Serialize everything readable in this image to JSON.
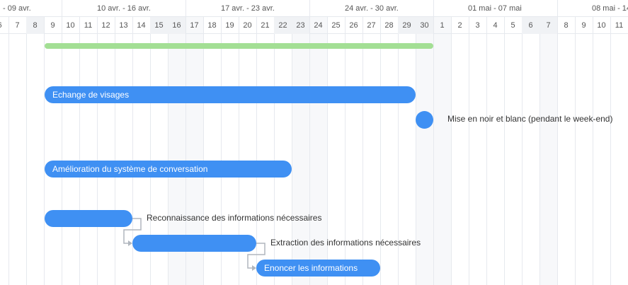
{
  "timeline": {
    "weeks": [
      "- 09 avr.",
      "10 avr. - 16 avr.",
      "17 avr. - 23 avr.",
      "24 avr. - 30 avr.",
      "01 mai - 07 mai",
      "08 mai - 14"
    ],
    "days": [
      "6",
      "7",
      "8",
      "9",
      "10",
      "11",
      "12",
      "13",
      "14",
      "15",
      "16",
      "17",
      "18",
      "19",
      "20",
      "21",
      "22",
      "23",
      "24",
      "25",
      "26",
      "27",
      "28",
      "29",
      "30",
      "1",
      "2",
      "3",
      "4",
      "5",
      "6",
      "7",
      "8",
      "9",
      "10",
      "11"
    ],
    "weekend_days": [
      [
        2,
        "8"
      ],
      [
        9,
        "15"
      ],
      [
        10,
        "16"
      ],
      [
        16,
        "22"
      ],
      [
        17,
        "23"
      ],
      [
        23,
        "29"
      ],
      [
        24,
        "30"
      ],
      [
        30,
        "6"
      ],
      [
        31,
        "7"
      ]
    ]
  },
  "tasks": [
    {
      "id": "summary",
      "name": "",
      "type": "summary",
      "start": "9 avr.",
      "end": "30 avr.",
      "color": "#a3df94"
    },
    {
      "id": "t1",
      "name": "Echange de visages",
      "type": "task",
      "start": "9 avr.",
      "end": "29 avr."
    },
    {
      "id": "m1",
      "name": "Mise en noir et blanc (pendant le week-end)",
      "type": "milestone",
      "date": "30 avr."
    },
    {
      "id": "t2",
      "name": "Amélioration du système de conversation",
      "type": "task",
      "start": "9 avr.",
      "end": "22 avr."
    },
    {
      "id": "t3",
      "name": "Reconnaissance des informations nécessaires",
      "type": "task",
      "start": "9 avr.",
      "end": "13 avr."
    },
    {
      "id": "t4",
      "name": "Extraction des informations nécessaires",
      "type": "task",
      "start": "14 avr.",
      "end": "20 avr."
    },
    {
      "id": "t5",
      "name": "Enoncer les informations",
      "type": "task",
      "start": "21 avr.",
      "end": "27 avr."
    }
  ],
  "colors": {
    "task": "#3f90f3",
    "summary": "#a3df94",
    "link": "#b0b6be"
  }
}
